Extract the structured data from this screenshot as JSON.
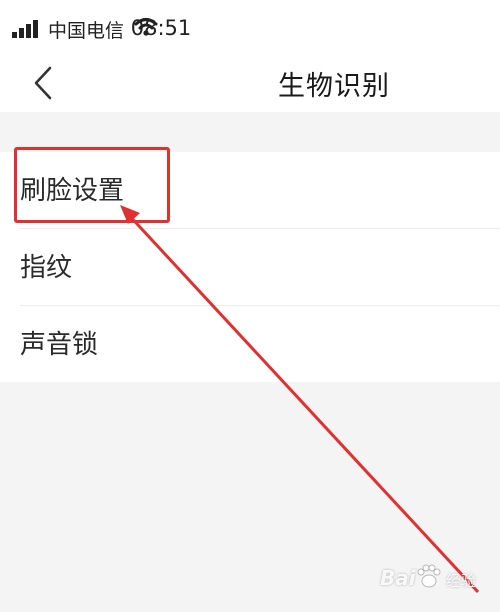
{
  "status_bar": {
    "carrier": "中国电信",
    "time": "08:51",
    "signal_icon": "signal-bars-icon",
    "wifi_icon": "wifi-icon"
  },
  "nav": {
    "back_icon": "chevron-left-icon",
    "title": "生物识别"
  },
  "list": {
    "items": [
      {
        "label": "刷脸设置"
      },
      {
        "label": "指纹"
      },
      {
        "label": "声音锁"
      }
    ]
  },
  "annotation": {
    "color": "#e03030",
    "highlighted_item": "刷脸设置"
  },
  "watermark": {
    "brand": "Bai",
    "suffix": "经验"
  }
}
